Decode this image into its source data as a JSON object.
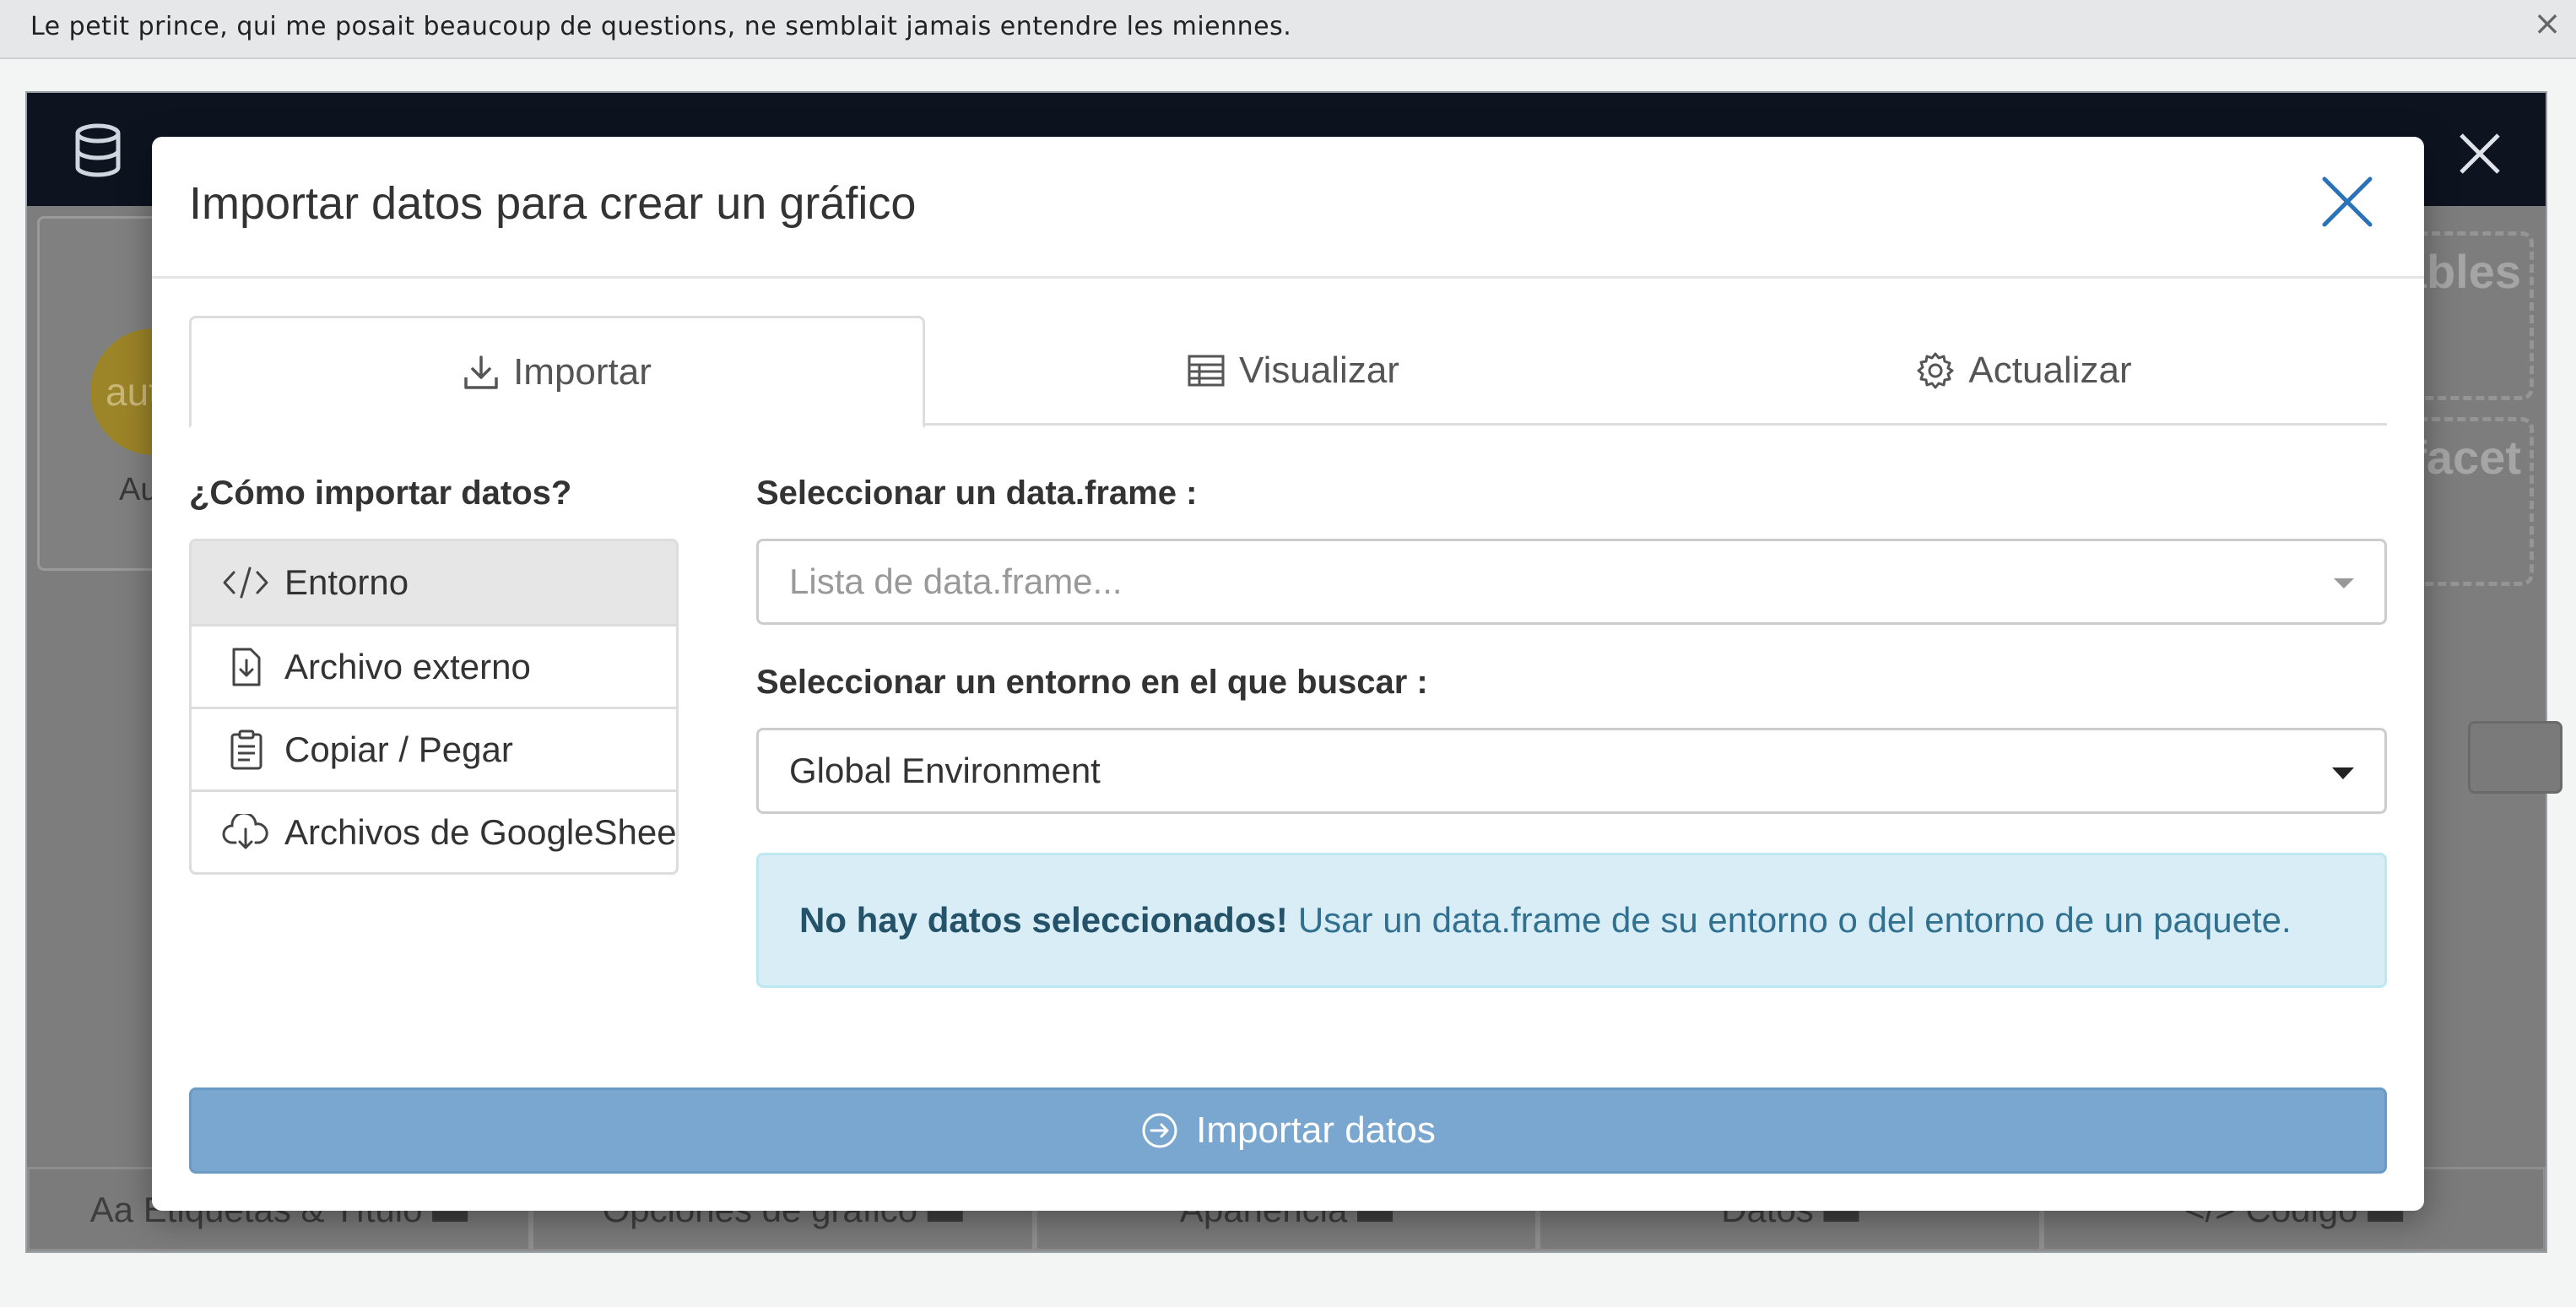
{
  "banner": {
    "message": "Le petit prince, qui me posait beaucoup de questions, ne semblait jamais entendre les miennes.",
    "close_glyph": "×"
  },
  "background": {
    "avatar_text": "aut",
    "left_label": "Aut",
    "dash_box_1": "ables",
    "dash_box_2": "facet",
    "bottom_tabs": [
      "Aa Etiquetas & Título ▬",
      "Opciones de gráfico ▬",
      "Apariencia ▬",
      "Datos ▬",
      "</> Código ▬"
    ]
  },
  "modal": {
    "title": "Importar datos para crear un gráfico",
    "tabs": [
      {
        "label": "Importar",
        "icon": "download-icon"
      },
      {
        "label": "Visualizar",
        "icon": "table-icon"
      },
      {
        "label": "Actualizar",
        "icon": "gear-icon"
      }
    ],
    "how_label": "¿Cómo importar datos?",
    "methods": [
      {
        "label": "Entorno",
        "icon": "code-icon"
      },
      {
        "label": "Archivo externo",
        "icon": "file-import-icon"
      },
      {
        "label": "Copiar / Pegar",
        "icon": "clipboard-icon"
      },
      {
        "label": "Archivos de GoogleSheets",
        "icon": "cloud-download-icon"
      }
    ],
    "dataframe_label": "Seleccionar un data.frame :",
    "dataframe_placeholder": "Lista de data.frame...",
    "env_label": "Seleccionar un entorno en el que buscar :",
    "env_value": "Global Environment",
    "alert_strong": "No hay datos seleccionados!",
    "alert_text": "Usar un data.frame de su entorno o del entorno de un paquete.",
    "import_button": "Importar datos"
  },
  "colors": {
    "primary_button": "#7aa7cf",
    "alert_bg": "#d9edf7",
    "close_icon": "#2a73b8",
    "header_dark": "#0d1420"
  }
}
